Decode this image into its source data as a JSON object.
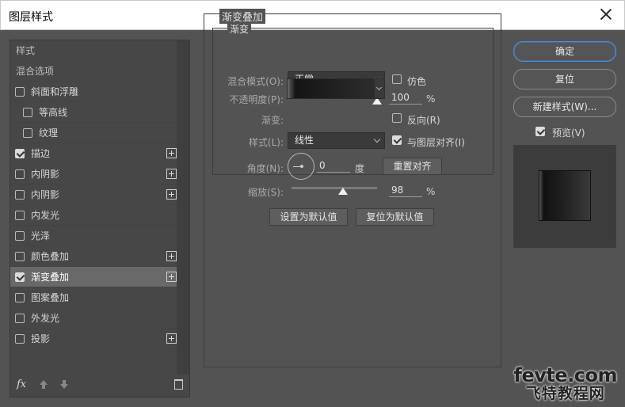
{
  "window": {
    "title": "图层样式"
  },
  "left_panel": {
    "items": [
      {
        "label": "样式",
        "type": "plain"
      },
      {
        "label": "混合选项",
        "type": "plain"
      },
      {
        "label": "斜面和浮雕",
        "checkbox": true,
        "checked": false,
        "plus": false
      },
      {
        "label": "等高线",
        "checkbox": true,
        "checked": false,
        "indent": true
      },
      {
        "label": "纹理",
        "checkbox": true,
        "checked": false,
        "indent": true
      },
      {
        "label": "描边",
        "checkbox": true,
        "checked": true,
        "plus": true
      },
      {
        "label": "内阴影",
        "checkbox": true,
        "checked": false,
        "plus": true
      },
      {
        "label": "内阴影",
        "checkbox": true,
        "checked": false,
        "plus": true
      },
      {
        "label": "内发光",
        "checkbox": true,
        "checked": false
      },
      {
        "label": "光泽",
        "checkbox": true,
        "checked": false
      },
      {
        "label": "颜色叠加",
        "checkbox": true,
        "checked": false,
        "plus": true
      },
      {
        "label": "渐变叠加",
        "checkbox": true,
        "checked": true,
        "plus": true,
        "active": true
      },
      {
        "label": "图案叠加",
        "checkbox": true,
        "checked": false
      },
      {
        "label": "外发光",
        "checkbox": true,
        "checked": false
      },
      {
        "label": "投影",
        "checkbox": true,
        "checked": false,
        "plus": true
      }
    ],
    "footer_fx": "fx"
  },
  "gradient_overlay": {
    "section_title": "渐变叠加",
    "sub_title": "渐变",
    "blend_mode_label": "混合模式(O):",
    "blend_mode_value": "正常",
    "dither_label": "仿色",
    "dither_checked": false,
    "opacity_label": "不透明度(P):",
    "opacity_value": "100",
    "opacity_fraction": 1.0,
    "opacity_unit": "%",
    "gradient_label": "渐变:",
    "reverse_label": "反向(R)",
    "reverse_checked": false,
    "style_label": "样式(L):",
    "style_value": "线性",
    "align_label": "与图层对齐(I)",
    "align_checked": true,
    "angle_label": "角度(N):",
    "angle_value": "0",
    "angle_unit": "度",
    "reset_align_label": "重置对齐",
    "scale_label": "缩放(S):",
    "scale_value": "98",
    "scale_fraction": 0.98,
    "scale_unit": "%",
    "set_default_label": "设置为默认值",
    "reset_default_label": "复位为默认值"
  },
  "right_panel": {
    "ok_label": "确定",
    "reset_label": "复位",
    "new_style_label": "新建样式(W)...",
    "preview_label": "预览(V)",
    "preview_checked": true
  },
  "watermark": {
    "top": "fevte.com",
    "bottom": "飞特教程网"
  }
}
